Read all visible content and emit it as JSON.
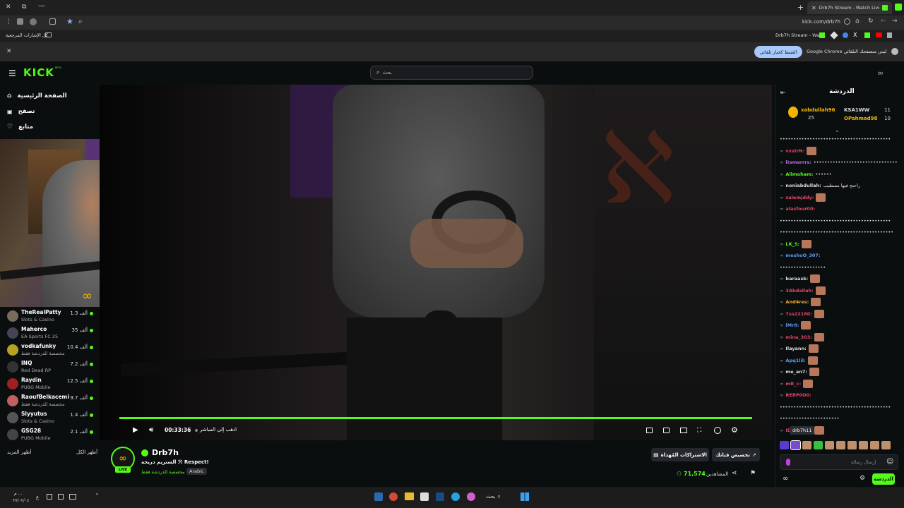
{
  "browser": {
    "tab_title": "Drb7h Stream - Watch Live on",
    "url": "kick.com/drb7h",
    "bookmarks_label": "كل الإشارات المرجعية",
    "bookmark_tab": "Drb7h Stream - Wat...",
    "infobar_text": "Google Chrome ليس متصفحك التلقائي",
    "infobar_button": "الضبط كخيار تلقائي"
  },
  "kick": {
    "logo": "KICK",
    "logo_badge": "BETA",
    "search_placeholder": "بحث",
    "nav": [
      {
        "label": "الصفحة الرئيسية",
        "icon": "home-icon"
      },
      {
        "label": "تصفح",
        "icon": "browse-icon"
      },
      {
        "label": "متابع",
        "icon": "heart-icon"
      }
    ],
    "channels": [
      {
        "name": "TheRealPatty",
        "category": "Slots & Casino",
        "viewers": "1.3 ألف"
      },
      {
        "name": "Maherco",
        "category": "EA Sports FC 25",
        "viewers": "35 ألف"
      },
      {
        "name": "vodkafunky",
        "category": "مخصصة للدردشة فقط",
        "viewers": "10.4 ألف"
      },
      {
        "name": "INQ",
        "category": "Red Dead RP",
        "viewers": "7.2 ألف"
      },
      {
        "name": "Raydin",
        "category": "PUBG Mobile",
        "viewers": "12.5 ألف"
      },
      {
        "name": "RaoufBelkacemi",
        "category": "مخصصة للدردشة فقط",
        "viewers": "9.7 ألف"
      },
      {
        "name": "Slyyutus",
        "category": "Slots & Casino",
        "viewers": "1.4 ألف"
      },
      {
        "name": "GSG28",
        "category": "PUBG Mobile",
        "viewers": "2.1 ألف"
      }
    ],
    "show_more": "أظهر المزيد",
    "show_all": "أظهر الكل",
    "player": {
      "time": "00:33:36",
      "go_live": "اذهب إلى المباشر",
      "progress": 1.0
    },
    "streamer": {
      "name": "Drb7h",
      "live_badge": "LIVE",
      "title": "الستريم دريحه ℛ Respect!",
      "category": "مخصصة للدردشة فقط",
      "language_tag": "Arabic",
      "viewers": "71,574",
      "viewers_label": "المشاهدين",
      "clip_button": "تخصيص قناتك",
      "gift_button": "الاشتراكات المُهداة"
    },
    "chat": {
      "title": "الدردشة",
      "leaderboard": [
        {
          "name": "xabdullah96",
          "value": "25"
        },
        {
          "name": "KSA1WW",
          "value": "11"
        },
        {
          "name": "OPahmad98",
          "value": "10"
        }
      ],
      "messages": [
        {
          "name": "",
          "text": "•••••••••••••••••••••••••••••••••••••••••",
          "color": "#dddddd"
        },
        {
          "name": "vxstrN:",
          "text": "",
          "color": "#e0476a",
          "emote": true
        },
        {
          "name": "itsmarrrs:",
          "text": "•••••••••••••••••••••••••••••••",
          "color": "#b96ef0"
        },
        {
          "name": "Alimoham:",
          "text": "••••••",
          "color": "#53fc18"
        },
        {
          "name": "noniabdullah:",
          "text": "راحنج فيها مسطيب",
          "color": "#dddddd"
        },
        {
          "name": "salemjddy:",
          "text": "",
          "color": "#e0476a",
          "emote": true
        },
        {
          "name": "alasfour00:",
          "text": "",
          "color": "#e0476a"
        },
        {
          "name": "",
          "text": "•••••••••••••••••••••••••••••••••••••••••",
          "color": "#dddddd"
        },
        {
          "name": "",
          "text": "••••••••••••••••••••••••••••••••••••••••••",
          "color": "#dddddd"
        },
        {
          "name": "LK_S:",
          "text": "",
          "color": "#53fc18",
          "emote": true
        },
        {
          "name": "meshoO_307:",
          "text": "",
          "color": "#5b9cf4"
        },
        {
          "name": "",
          "text": "•••••••••••••••••",
          "color": "#dddddd"
        },
        {
          "name": "baraask:",
          "text": "",
          "color": "#dddddd",
          "emote": true
        },
        {
          "name": "3Abdallah:",
          "text": "",
          "color": "#e0476a",
          "emote": true
        },
        {
          "name": "And4res:",
          "text": "",
          "color": "#f4a934",
          "emote": true
        },
        {
          "name": "7ss22180:",
          "text": "",
          "color": "#e0476a",
          "emote": true
        },
        {
          "name": "iMr8:",
          "text": "",
          "color": "#5b9cf4",
          "emote": true
        },
        {
          "name": "mina_303:",
          "text": "",
          "color": "#e0476a",
          "emote": true
        },
        {
          "name": "Ilayann:",
          "text": "",
          "color": "#dddddd",
          "emote": true
        },
        {
          "name": "Apq1lil:",
          "text": "",
          "color": "#5b9cf4",
          "emote": true
        },
        {
          "name": "me_an7:",
          "text": "",
          "color": "#dddddd",
          "emote": true
        },
        {
          "name": "mlt_c:",
          "text": "",
          "color": "#e0476a",
          "emote": true
        },
        {
          "name": "REBP0O0:",
          "text": "",
          "color": "#e0476a"
        },
        {
          "name": "",
          "text": "•••••••••••••••••••••••••••••••••••••••••",
          "color": "#dddddd"
        },
        {
          "name": "",
          "text": "••••••••••••••••••••••",
          "color": "#dddddd"
        },
        {
          "name": "IDZO_511:",
          "text": "",
          "color": "#e0476a",
          "emote": true
        }
      ],
      "tooltip": "drb7h11",
      "input_placeholder": "إرسال رسالة",
      "send_button": "الدردشة"
    }
  },
  "taskbar": {
    "search": "بحث",
    "time": "م ...",
    "date": "٢٧/٠٢/٠٤"
  }
}
